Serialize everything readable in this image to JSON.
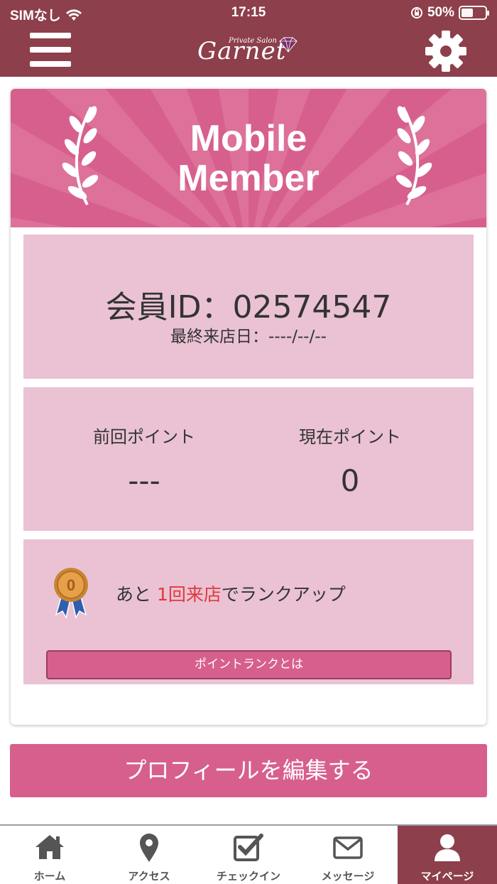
{
  "status_bar": {
    "carrier": "SIMなし",
    "time": "17:15",
    "battery": "50%",
    "battery_level": 0.5
  },
  "header": {
    "menu_icon": "hamburger-menu-icon",
    "logo_small": "Private Salon",
    "logo_main": "Garnet",
    "settings_icon": "gear-icon"
  },
  "banner": {
    "line1": "Mobile",
    "line2": "Member"
  },
  "member": {
    "id_label": "会員ID：02574547",
    "last_visit": "最終来店日：----/--/--"
  },
  "points": {
    "previous_label": "前回ポイント",
    "previous_value": "---",
    "current_label": "現在ポイント",
    "current_value": "0"
  },
  "rank": {
    "medal_number": "0",
    "text_before": "あと ",
    "text_accent": "1回来店",
    "text_after": "でランクアップ",
    "button_label": "ポイントランクとは"
  },
  "profile_button": "プロフィールを編集する",
  "tabs": [
    {
      "label": "ホーム",
      "icon": "home-icon"
    },
    {
      "label": "アクセス",
      "icon": "map-pin-icon"
    },
    {
      "label": "チェックイン",
      "icon": "checkbox-icon"
    },
    {
      "label": "メッセージ",
      "icon": "envelope-icon"
    },
    {
      "label": "マイページ",
      "icon": "user-icon"
    }
  ],
  "colors": {
    "header": "#8d3f4b",
    "banner": "#d75f8d",
    "panel": "#eac2d4",
    "accent_text": "#e03a3a"
  }
}
